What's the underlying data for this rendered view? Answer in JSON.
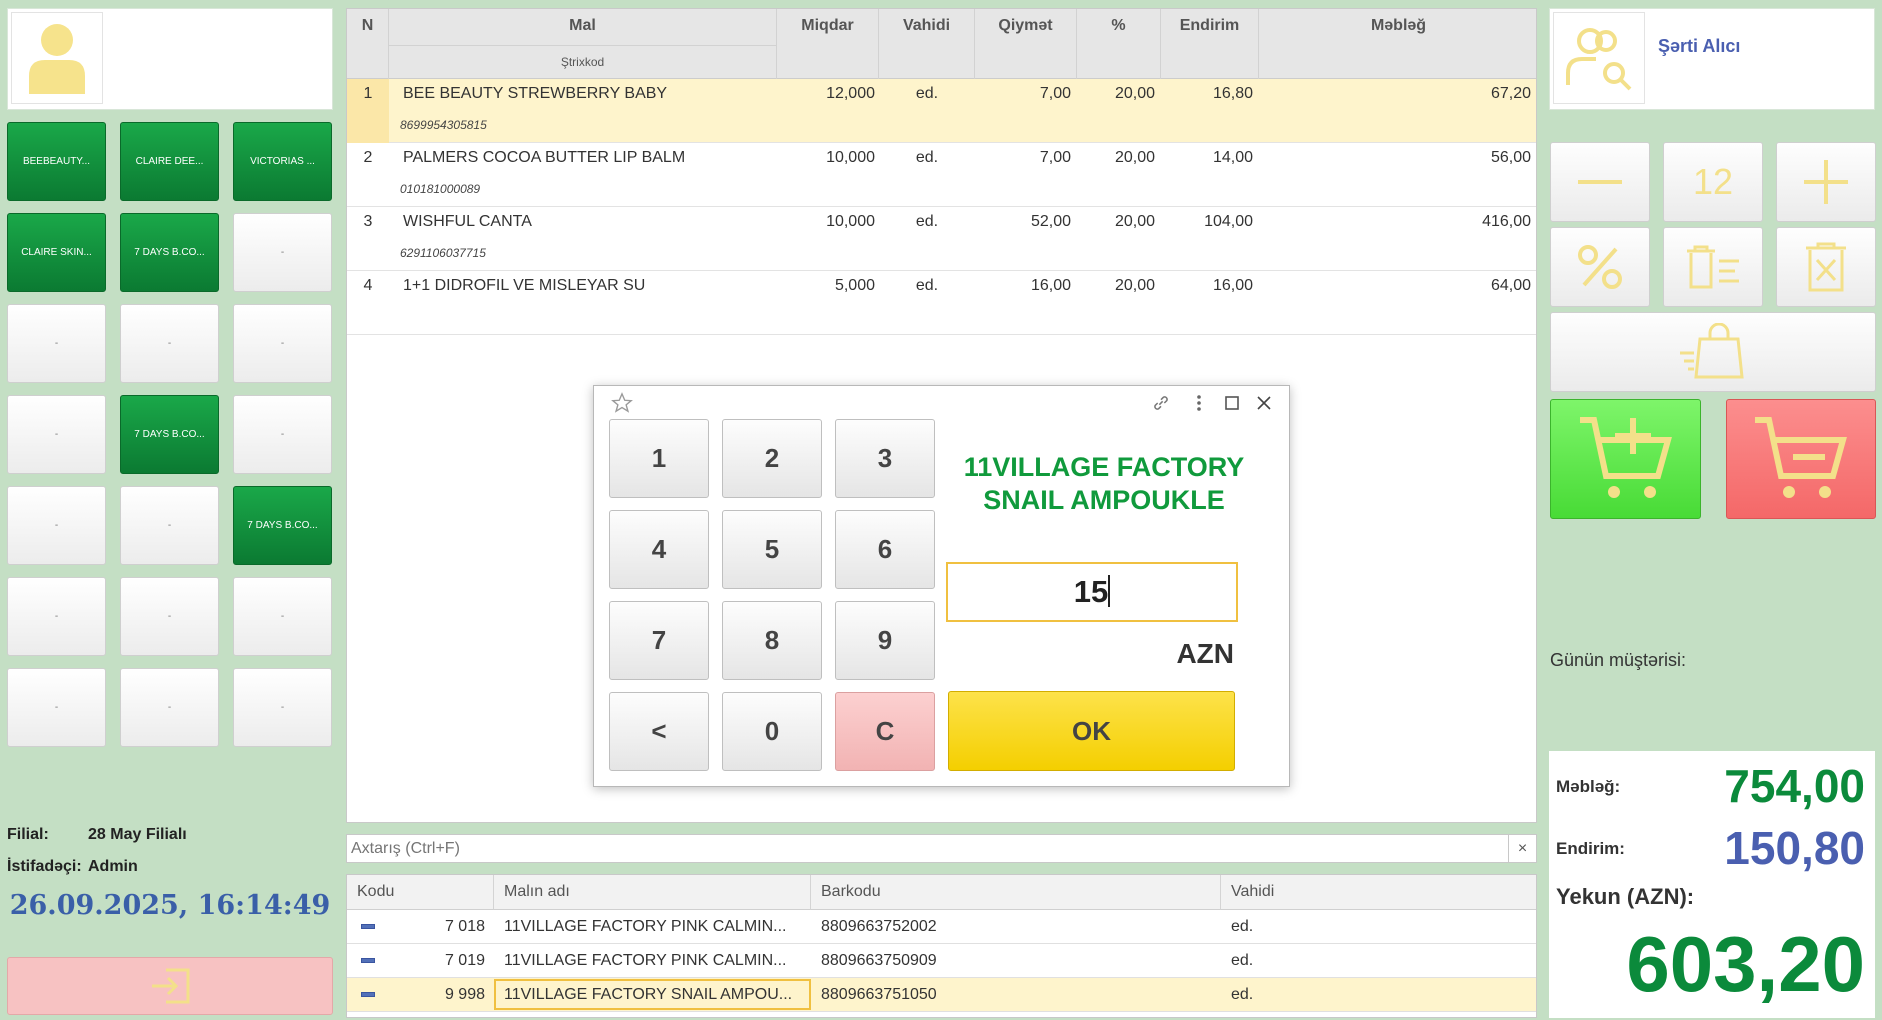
{
  "left": {
    "tiles": [
      {
        "label": "BEEBEAUTY...",
        "green": true
      },
      {
        "label": "CLAIRE DEE...",
        "green": true
      },
      {
        "label": "VICTORIAS ...",
        "green": true
      },
      {
        "label": "CLAIRE SKIN...",
        "green": true
      },
      {
        "label": "7 DAYS B.CO...",
        "green": true
      },
      {
        "label": "-",
        "green": false
      },
      {
        "label": "-",
        "green": false
      },
      {
        "label": "-",
        "green": false
      },
      {
        "label": "-",
        "green": false
      },
      {
        "label": "-",
        "green": false
      },
      {
        "label": "7 DAYS B.CO...",
        "green": true
      },
      {
        "label": "-",
        "green": false
      },
      {
        "label": "-",
        "green": false
      },
      {
        "label": "-",
        "green": false
      },
      {
        "label": "7 DAYS B.CO...",
        "green": true
      },
      {
        "label": "-",
        "green": false
      },
      {
        "label": "-",
        "green": false
      },
      {
        "label": "-",
        "green": false
      },
      {
        "label": "-",
        "green": false
      },
      {
        "label": "-",
        "green": false
      },
      {
        "label": "-",
        "green": false
      }
    ],
    "branch_label": "Filial:",
    "branch_value": "28 May Filialı",
    "user_label": "İstifadəçi:",
    "user_value": "Admin",
    "datetime": "26.09.2025, 16:14:49"
  },
  "main_table": {
    "headers": {
      "n": "N",
      "product": "Mal",
      "barcode": "Ştrixkod",
      "qty": "Miqdar",
      "unit": "Vahidi",
      "price": "Qiymət",
      "pct": "%",
      "discount": "Endirim",
      "amount": "Məbləğ"
    },
    "rows": [
      {
        "n": "1",
        "name": "BEE  BEAUTY STREWBERRY BABY",
        "barcode": "8699954305815",
        "qty": "12,000",
        "unit": "ed.",
        "price": "7,00",
        "pct": "20,00",
        "discount": "16,80",
        "amount": "67,20",
        "selected": true
      },
      {
        "n": "2",
        "name": "PALMERS COCOA BUTTER LIP BALM",
        "barcode": "010181000089",
        "qty": "10,000",
        "unit": "ed.",
        "price": "7,00",
        "pct": "20,00",
        "discount": "14,00",
        "amount": "56,00",
        "selected": false
      },
      {
        "n": "3",
        "name": "WISHFUL CANTA",
        "barcode": "6291106037715",
        "qty": "10,000",
        "unit": "ed.",
        "price": "52,00",
        "pct": "20,00",
        "discount": "104,00",
        "amount": "416,00",
        "selected": false
      },
      {
        "n": "4",
        "name": "1+1 DIDROFIL VE MISLEYAR SU",
        "barcode": "",
        "qty": "5,000",
        "unit": "ed.",
        "price": "16,00",
        "pct": "20,00",
        "discount": "16,00",
        "amount": "64,00",
        "selected": false
      }
    ]
  },
  "search": {
    "placeholder": "Axtarış (Ctrl+F)",
    "clear": "×"
  },
  "bottom_table": {
    "headers": {
      "code": "Kodu",
      "name": "Malın adı",
      "barcode": "Barkodu",
      "unit": "Vahidi"
    },
    "rows": [
      {
        "code": "7 018",
        "name": "11VILLAGE FACTORY PINK CALMIN...",
        "barcode": "8809663752002",
        "unit": "ed.",
        "selected": false
      },
      {
        "code": "7 019",
        "name": "11VILLAGE FACTORY PINK CALMIN...",
        "barcode": "8809663750909",
        "unit": "ed.",
        "selected": false
      },
      {
        "code": "9 998",
        "name": "11VILLAGE FACTORY SNAIL AMPOU...",
        "barcode": "8809663751050",
        "unit": "ed.",
        "selected": true
      }
    ]
  },
  "dialog": {
    "title_line1": "11VILLAGE FACTORY",
    "title_line2": "SNAIL AMPOUKLE",
    "input_value": "15",
    "currency": "AZN",
    "keys": [
      "1",
      "2",
      "3",
      "4",
      "5",
      "6",
      "7",
      "8",
      "9",
      "<",
      "0",
      "C"
    ],
    "ok": "OK"
  },
  "right": {
    "customer_label": "Şərti Alıcı",
    "qty_display": "12",
    "day_customer_label": "Günün müştərisi:",
    "sum_label": "Məbləğ:",
    "sum_value": "754,00",
    "discount_label": "Endirim:",
    "discount_value": "150,80",
    "total_label": "Yekun (AZN):",
    "total_value": "603,20"
  },
  "colors": {
    "accent_green": "#0b8a3b",
    "accent_blue": "#4a5fb0",
    "icon_yellow": "#f3e08a",
    "selected_row": "#fef4cc"
  }
}
